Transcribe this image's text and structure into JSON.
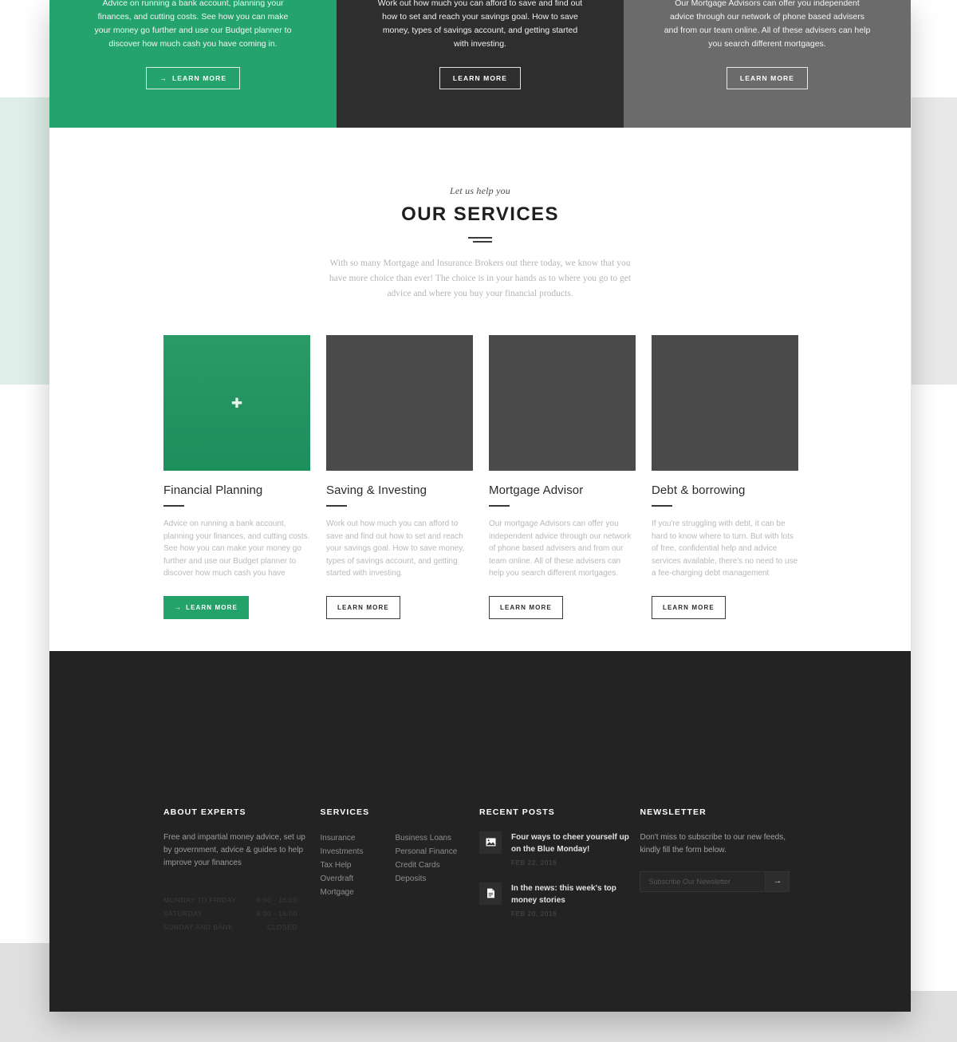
{
  "promos": [
    {
      "id": "financial-planning",
      "text": "Advice on running a bank account, planning your finances, and cutting costs. See how you can make your money go further and use our Budget planner to discover how much cash you have coming in.",
      "button": "LEARN MORE",
      "arrow": "→",
      "color": "#24a36c"
    },
    {
      "id": "saving-investing",
      "text": "Work out how much you can afford to save and find out how to set and reach your savings goal. How to save money, types of savings account, and getting started with investing.",
      "button": "LEARN MORE",
      "arrow": "",
      "color": "#2e2e2e"
    },
    {
      "id": "mortgage-advisor",
      "text": "Our Mortgage Advisors can offer you independent advice through our network of phone based advisers and from our team online. All of these advisers can help you search different mortgages.",
      "button": "LEARN MORE",
      "arrow": "",
      "color": "#6b6b6b"
    }
  ],
  "services": {
    "kicker": "Let us help you",
    "title": "OUR SERVICES",
    "subtitle": "With so many Mortgage and Insurance Brokers out there today, we know that you have more choice than ever! The choice is in your hands as to where you go to get advice and where you buy your financial products.",
    "cards": [
      {
        "title": "Financial Planning",
        "desc": "Advice on running a bank account, planning your finances, and cutting costs. See how you can make your money go further and use our Budget planner to discover how much cash you have",
        "button": "LEARN MORE",
        "arrow": "→",
        "thumb": "green",
        "thumb_icon": "plus-icon"
      },
      {
        "title": "Saving & Investing",
        "desc": "Work out how much you can afford to save and find out how to set and reach your savings goal. How to save money, types of savings account, and getting started with investing.",
        "button": "LEARN MORE",
        "arrow": "",
        "thumb": "dark",
        "thumb_icon": ""
      },
      {
        "title": "Mortgage Advisor",
        "desc": "Our mortgage Advisors can offer you independent advice through our network of phone based advisers and from our team online. All of these advisers can help you search different mortgages.",
        "button": "LEARN MORE",
        "arrow": "",
        "thumb": "dark",
        "thumb_icon": ""
      },
      {
        "title": "Debt & borrowing",
        "desc": "If you're struggling with debt, it can be hard to know where to turn. But with lots of free, confidential help and advice services available, there's no need to use a fee-charging debt management",
        "button": "LEARN MORE",
        "arrow": "",
        "thumb": "dark",
        "thumb_icon": ""
      }
    ]
  },
  "footer": {
    "about": {
      "heading": "ABOUT EXPERTS",
      "text": "Free and impartial money advice, set up by government, advice & guides to help improve your finances",
      "hours": [
        {
          "day": "MONDAY TO FRIDAY",
          "time": "8:00 - 16:00"
        },
        {
          "day": "SATURDAY",
          "time": "8:00 - 16:00"
        },
        {
          "day": "SUNDAY AND BANK",
          "time": "CLOSED"
        }
      ]
    },
    "services": {
      "heading": "SERVICES",
      "col1": [
        "Insurance",
        "Investments",
        "Tax Help",
        "Overdraft",
        "Mortgage"
      ],
      "col2": [
        "Business Loans",
        "Personal Finance",
        "Credit Cards",
        "Deposits"
      ]
    },
    "posts": {
      "heading": "RECENT POSTS",
      "items": [
        {
          "title": "Four ways to cheer yourself up on the Blue Monday!",
          "date": "FEB 22, 2016",
          "icon": "image-icon"
        },
        {
          "title": "In the news: this week's top money stories",
          "date": "FEB 20, 2016",
          "icon": "document-icon"
        }
      ]
    },
    "newsletter": {
      "heading": "NEWSLETTER",
      "text": "Don't miss to subscribe to our new feeds, kindly fill the form below.",
      "placeholder": "Subscribe Our Newsletter",
      "value": "",
      "submit": "→"
    }
  },
  "theme": {
    "accent": "#23a36a",
    "dark": "#232323",
    "gray": "#6b6b6b",
    "band_left": "#dfeee8",
    "band_right": "#e8e8e8"
  }
}
